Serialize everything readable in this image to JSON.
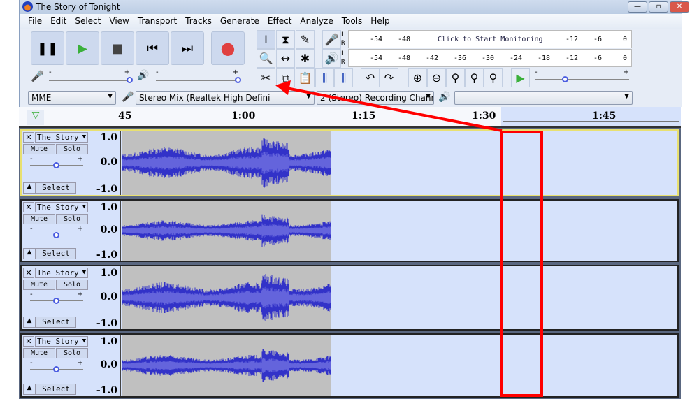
{
  "window": {
    "title": "The Story of Tonight",
    "minimize": "—",
    "maximize": "▫",
    "close": "✕"
  },
  "menu": [
    "File",
    "Edit",
    "Select",
    "View",
    "Transport",
    "Tracks",
    "Generate",
    "Effect",
    "Analyze",
    "Tools",
    "Help"
  ],
  "transport": {
    "pause": "❚❚",
    "play": "▶",
    "stop": "■",
    "skip_start": "⏮",
    "skip_end": "⏭",
    "record": "●"
  },
  "tools": {
    "selection": "I",
    "envelope": "⧗",
    "draw": "✎",
    "zoom": "🔍",
    "timeshift": "↔",
    "multi": "✱",
    "cut": "✂",
    "copy": "⧉",
    "paste": "📋",
    "undo": "↶",
    "redo": "↷"
  },
  "meters": {
    "record_prompt": "Click to Start Monitoring",
    "scale": [
      "-54",
      "-48",
      "-42",
      "-36",
      "-30",
      "-24",
      "-18",
      "-12",
      "-6",
      "0"
    ],
    "l": "L",
    "r": "R"
  },
  "sliders": {
    "minus": "-",
    "plus": "+"
  },
  "device": {
    "host": "MME",
    "input": "Stereo Mix (Realtek High Defini",
    "channels": "2 (Stereo) Recording Chann",
    "output": ""
  },
  "ruler": {
    "labels": [
      "45",
      "1:00",
      "1:15",
      "1:30",
      "1:45"
    ]
  },
  "tracks": [
    {
      "name": "The Story",
      "mute": "Mute",
      "solo": "Solo",
      "select": "Select",
      "scale": [
        "1.0",
        "0.0",
        "-1.0"
      ],
      "focused": true,
      "tail_clip": false
    },
    {
      "name": "The Story",
      "mute": "Mute",
      "solo": "Solo",
      "select": "Select",
      "scale": [
        "1.0",
        "0.0",
        "-1.0"
      ],
      "focused": false,
      "tail_clip": true
    },
    {
      "name": "The Story",
      "mute": "Mute",
      "solo": "Solo",
      "select": "Select",
      "scale": [
        "1.0",
        "0.0",
        "-1.0"
      ],
      "focused": false,
      "tail_clip": false
    },
    {
      "name": "The Story",
      "mute": "Mute",
      "solo": "Solo",
      "select": "Select",
      "scale": [
        "1.0",
        "0.0",
        "-1.0"
      ],
      "focused": false,
      "tail_clip": true
    }
  ],
  "colors": {
    "wave": "#3232c8",
    "wave_rms": "#6464dc",
    "annotation": "#ff0000",
    "selection": "#d6e2fb"
  }
}
